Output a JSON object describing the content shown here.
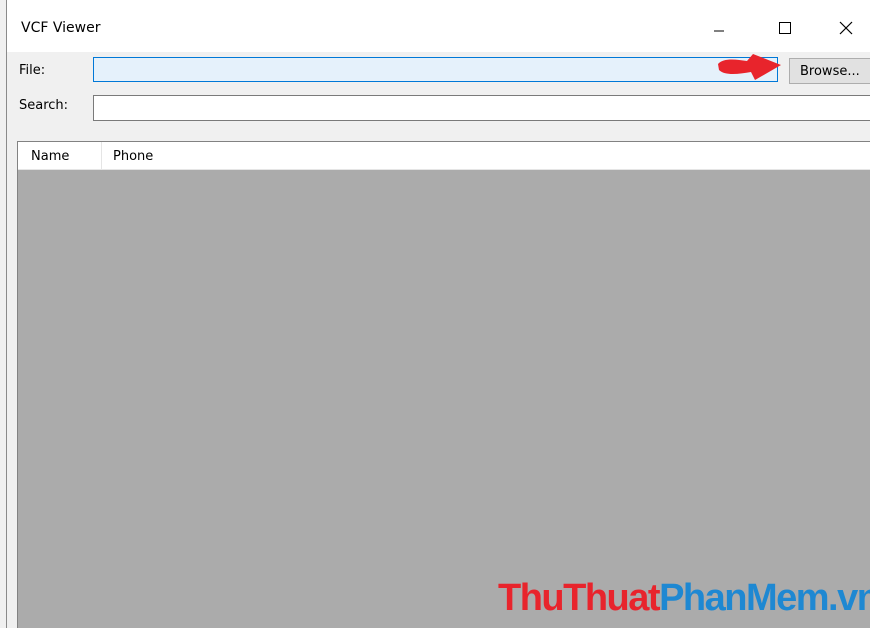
{
  "window": {
    "title": "VCF Viewer"
  },
  "form": {
    "file_label": "File:",
    "file_value": "",
    "search_label": "Search:",
    "search_value": "",
    "browse_label": "Browse..."
  },
  "list": {
    "columns": [
      "Name",
      "Phone"
    ]
  },
  "annotation": {
    "arrow_color": "#e8242c"
  },
  "watermark": {
    "part1": "ThuThuat",
    "part2": "PhanMem",
    "part3": ".vn",
    "color1": "#e8242c",
    "color2": "#1e88d2"
  }
}
